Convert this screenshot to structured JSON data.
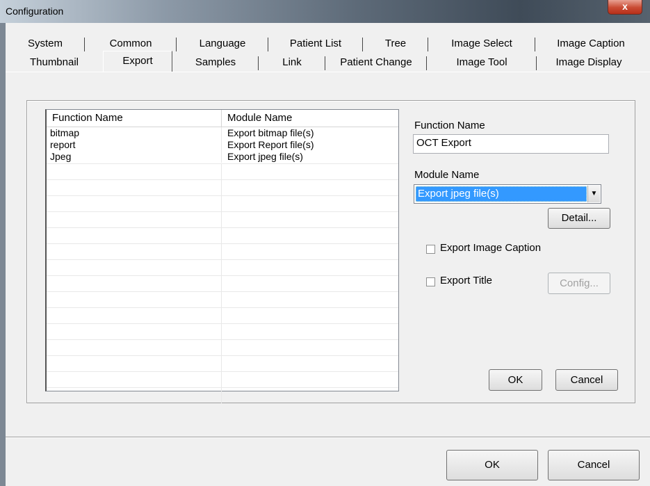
{
  "window": {
    "title": "Configuration",
    "close_label": "x"
  },
  "tabs": {
    "row1": [
      "System",
      "Common",
      "Language",
      "Patient List",
      "Tree",
      "Image Select",
      "Image Caption"
    ],
    "row2": [
      "Thumbnail",
      "Export",
      "Samples",
      "Link",
      "Patient Change",
      "Image Tool",
      "Image Display"
    ],
    "active": "Export"
  },
  "list": {
    "columns": [
      "Function Name",
      "Module Name"
    ],
    "rows": [
      {
        "function": "bitmap",
        "module": "Export bitmap file(s)"
      },
      {
        "function": "report",
        "module": "Export Report file(s)"
      },
      {
        "function": "Jpeg",
        "module": "Export jpeg file(s)"
      }
    ]
  },
  "form": {
    "function_name_label": "Function Name",
    "function_name_value": "OCT Export",
    "module_name_label": "Module Name",
    "module_name_value": "Export jpeg file(s)",
    "detail_button": "Detail...",
    "export_image_caption_label": "Export Image Caption",
    "export_image_caption_checked": false,
    "export_title_label": "Export Title",
    "export_title_checked": false,
    "config_button": "Config...",
    "ok_button": "OK",
    "cancel_button": "Cancel"
  },
  "footer": {
    "ok_button": "OK",
    "cancel_button": "Cancel"
  }
}
